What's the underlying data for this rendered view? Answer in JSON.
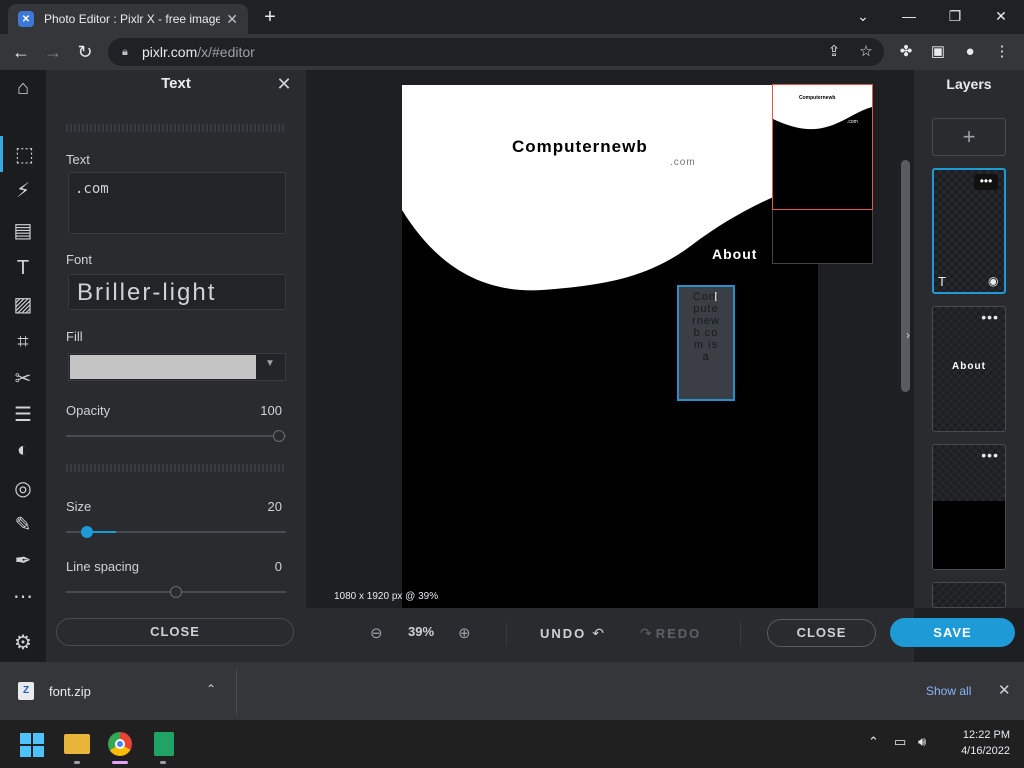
{
  "browser": {
    "tab_title": "Photo Editor : Pixlr X - free image",
    "url_host": "pixlr.com",
    "url_path": "/x/#editor"
  },
  "text_panel": {
    "title": "Text",
    "text_label": "Text",
    "text_value": ".com",
    "font_label": "Font",
    "font_value": "Briller-light",
    "fill_label": "Fill",
    "fill_color": "#c4c4c4",
    "opacity_label": "Opacity",
    "opacity_value": "100",
    "opacity_level": 1.0,
    "size_label": "Size",
    "size_value": "20",
    "line_spacing_label": "Line spacing",
    "line_spacing_value": "0",
    "close_label": "CLOSE"
  },
  "canvas": {
    "title_text": "Computernewb",
    "subtitle_text": ".com",
    "about_text": "About",
    "vertical_text": [
      "Com",
      "pute",
      "rnew",
      "b co",
      "m is",
      "a"
    ],
    "dimensions_label": "1080 x 1920 px @ 39%",
    "thumbnail_title": "Computernewb",
    "thumbnail_sub": ".com"
  },
  "bottom_bar": {
    "zoom_value": "39%",
    "undo_label": "UNDO",
    "redo_label": "REDO",
    "close_label": "CLOSE",
    "save_label": "SAVE"
  },
  "layers_panel": {
    "title": "Layers",
    "add_label": "+",
    "layer2_text": "About"
  },
  "download_bar": {
    "file_name": "font.zip",
    "show_all": "Show all"
  },
  "taskbar": {
    "time": "12:22 PM",
    "date": "4/16/2022"
  },
  "colors": {
    "accent": "#1e9ad6",
    "save_button": "#1e9ad6"
  }
}
